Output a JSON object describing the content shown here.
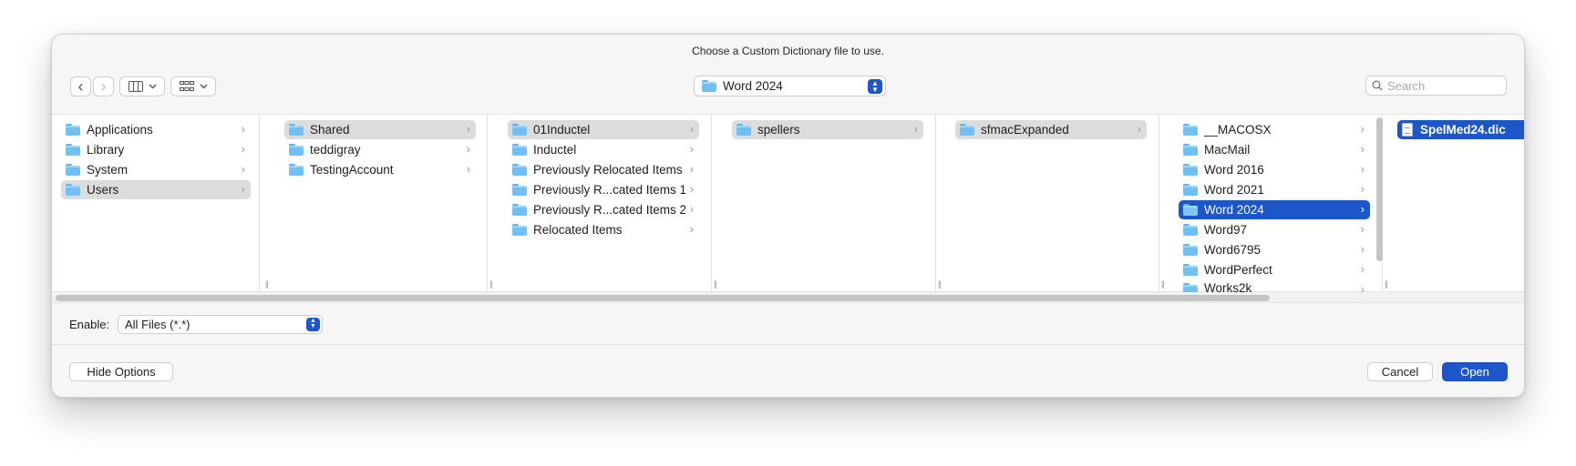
{
  "dialog": {
    "title": "Choose a Custom Dictionary file to use."
  },
  "toolbar": {
    "back_glyph": "‹",
    "forward_glyph": "›",
    "path_popup": "Word 2024",
    "search_placeholder": "Search"
  },
  "columns": [
    {
      "items": [
        {
          "label": "Applications",
          "chevron": true,
          "state": "none"
        },
        {
          "label": "Library",
          "chevron": true,
          "state": "none"
        },
        {
          "label": "System",
          "chevron": true,
          "state": "none"
        },
        {
          "label": "Users",
          "chevron": true,
          "state": "gray"
        }
      ]
    },
    {
      "items": [
        {
          "label": "Shared",
          "chevron": true,
          "state": "gray"
        },
        {
          "label": "teddigray",
          "chevron": true,
          "state": "none"
        },
        {
          "label": "TestingAccount",
          "chevron": true,
          "state": "none"
        }
      ]
    },
    {
      "items": [
        {
          "label": "01Inductel",
          "chevron": true,
          "state": "gray"
        },
        {
          "label": "Inductel",
          "chevron": true,
          "state": "none"
        },
        {
          "label": "Previously Relocated Items",
          "chevron": true,
          "state": "none"
        },
        {
          "label": "Previously R...cated Items 1",
          "chevron": true,
          "state": "none"
        },
        {
          "label": "Previously R...cated Items 2",
          "chevron": true,
          "state": "none"
        },
        {
          "label": "Relocated Items",
          "chevron": true,
          "state": "none"
        }
      ]
    },
    {
      "items": [
        {
          "label": "spellers",
          "chevron": true,
          "state": "gray"
        }
      ]
    },
    {
      "items": [
        {
          "label": "sfmacExpanded",
          "chevron": true,
          "state": "gray"
        }
      ]
    },
    {
      "items": [
        {
          "label": "__MACOSX",
          "chevron": true,
          "state": "none"
        },
        {
          "label": "MacMail",
          "chevron": true,
          "state": "none"
        },
        {
          "label": "Word 2016",
          "chevron": true,
          "state": "none"
        },
        {
          "label": "Word 2021",
          "chevron": true,
          "state": "none"
        },
        {
          "label": "Word 2024",
          "chevron": true,
          "state": "blue"
        },
        {
          "label": "Word97",
          "chevron": true,
          "state": "none"
        },
        {
          "label": "Word6795",
          "chevron": true,
          "state": "none"
        },
        {
          "label": "WordPerfect",
          "chevron": true,
          "state": "none"
        },
        {
          "label": "Works2k",
          "chevron": true,
          "state": "none"
        }
      ]
    },
    {
      "items": [
        {
          "label": "SpelMed24.dic",
          "chevron": false,
          "state": "blue",
          "file": true
        }
      ]
    }
  ],
  "options": {
    "enable_label": "Enable:",
    "enable_value": "All Files (*.*)"
  },
  "buttons": {
    "hide_options": "Hide Options",
    "cancel": "Cancel",
    "open": "Open"
  },
  "colors": {
    "accent": "#1c56c9",
    "selection_gray": "#dcdcdc",
    "folder": "#71c0f3"
  }
}
